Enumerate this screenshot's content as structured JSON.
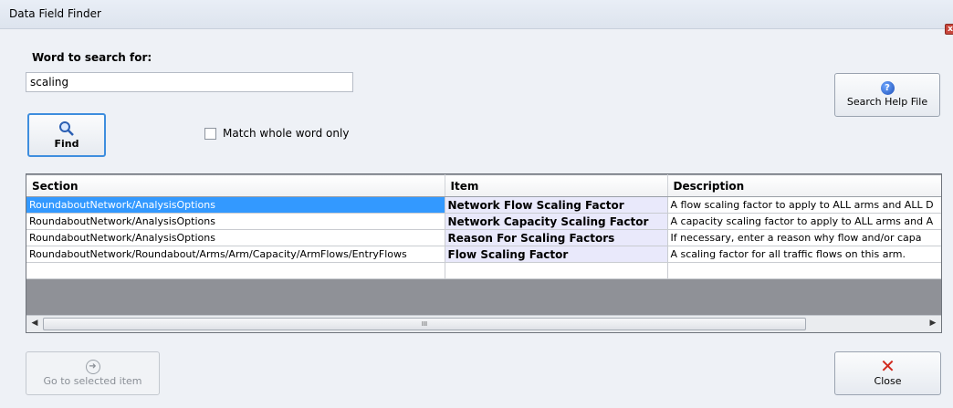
{
  "window": {
    "title": "Data Field Finder"
  },
  "search": {
    "label": "Word to search for:",
    "value": "scaling"
  },
  "buttons": {
    "find": "Find",
    "search_help": "Search Help File",
    "goto": "Go to selected item",
    "close": "Close"
  },
  "options": {
    "match_whole_word_label": "Match whole word only",
    "match_whole_word_checked": false
  },
  "grid": {
    "columns": [
      "Section",
      "Item",
      "Description"
    ],
    "rows": [
      {
        "section": "RoundaboutNetwork/AnalysisOptions",
        "item": "Network Flow Scaling Factor",
        "description": "A flow scaling factor to apply to ALL arms and ALL D",
        "selected": true
      },
      {
        "section": "RoundaboutNetwork/AnalysisOptions",
        "item": "Network Capacity Scaling Factor",
        "description": "A capacity scaling factor to apply to ALL arms and A",
        "selected": false
      },
      {
        "section": "RoundaboutNetwork/AnalysisOptions",
        "item": "Reason For Scaling Factors",
        "description": "If necessary, enter a reason why flow and/or capa",
        "selected": false
      },
      {
        "section": "RoundaboutNetwork/Roundabout/Arms/Arm/Capacity/ArmFlows/EntryFlows",
        "item": "Flow Scaling Factor",
        "description": "A scaling factor for all traffic flows on this arm.",
        "selected": false
      }
    ],
    "scrollbar_thumb_label": "III"
  },
  "icons": {
    "find": "magnifier-icon",
    "help": "question-icon",
    "goto": "arrow-right-circle-icon",
    "close": "red-x-icon"
  },
  "colors": {
    "selection": "#3399ff",
    "item_cell": "#e9e9fb",
    "accent": "#3e8ede"
  }
}
